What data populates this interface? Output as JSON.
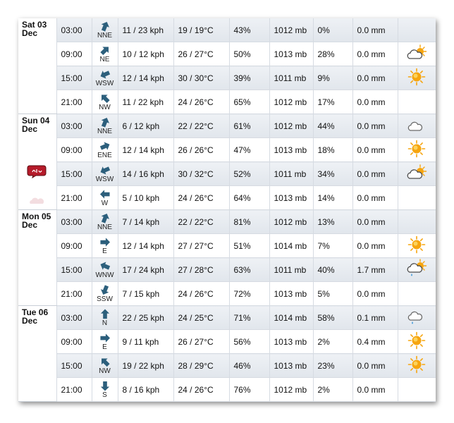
{
  "days": [
    {
      "day_line1": "Sat 03",
      "day_line2": "Dec",
      "rows": [
        {
          "time": "03:00",
          "wind_dir": "NNE",
          "wind_angle": 202,
          "wind_speed": "11 / 23 kph",
          "temp": "19 / 19°C",
          "humidity": "43%",
          "pressure": "1012 mb",
          "rain_chance": "0%",
          "rain_amount": "0.0 mm",
          "icon": "moon-icon"
        },
        {
          "time": "09:00",
          "wind_dir": "NE",
          "wind_angle": 225,
          "wind_speed": "10 / 12 kph",
          "temp": "26 / 27°C",
          "humidity": "50%",
          "pressure": "1013 mb",
          "rain_chance": "28%",
          "rain_amount": "0.0 mm",
          "icon": "sun-cloud-icon"
        },
        {
          "time": "15:00",
          "wind_dir": "WSW",
          "wind_angle": 67,
          "wind_speed": "12 / 14 kph",
          "temp": "30 / 30°C",
          "humidity": "39%",
          "pressure": "1011 mb",
          "rain_chance": "9%",
          "rain_amount": "0.0 mm",
          "icon": "sun-icon"
        },
        {
          "time": "21:00",
          "wind_dir": "NW",
          "wind_angle": 135,
          "wind_speed": "11 / 22 kph",
          "temp": "24 / 26°C",
          "humidity": "65%",
          "pressure": "1012 mb",
          "rain_chance": "17%",
          "rain_amount": "0.0 mm",
          "icon": "moon-icon"
        }
      ]
    },
    {
      "day_line1": "Sun 04",
      "day_line2": "Dec",
      "badge_icon": "speech-bubble-badge-icon",
      "rows": [
        {
          "time": "03:00",
          "wind_dir": "NNE",
          "wind_angle": 202,
          "wind_speed": "6 / 12 kph",
          "temp": "22 / 22°C",
          "humidity": "61%",
          "pressure": "1012 mb",
          "rain_chance": "44%",
          "rain_amount": "0.0 mm",
          "icon": "cloud-moon-icon"
        },
        {
          "time": "09:00",
          "wind_dir": "ENE",
          "wind_angle": 247,
          "wind_speed": "12 / 14 kph",
          "temp": "26 / 26°C",
          "humidity": "47%",
          "pressure": "1013 mb",
          "rain_chance": "18%",
          "rain_amount": "0.0 mm",
          "icon": "sun-icon"
        },
        {
          "time": "15:00",
          "wind_dir": "WSW",
          "wind_angle": 67,
          "wind_speed": "14 / 16 kph",
          "temp": "30 / 32°C",
          "humidity": "52%",
          "pressure": "1011 mb",
          "rain_chance": "34%",
          "rain_amount": "0.0 mm",
          "icon": "sun-cloud-icon"
        },
        {
          "time": "21:00",
          "wind_dir": "W",
          "wind_angle": 90,
          "wind_speed": "5 / 10 kph",
          "temp": "24 / 26°C",
          "humidity": "64%",
          "pressure": "1013 mb",
          "rain_chance": "14%",
          "rain_amount": "0.0 mm",
          "icon": "moon-icon"
        }
      ]
    },
    {
      "day_line1": "Mon 05",
      "day_line2": "Dec",
      "rows": [
        {
          "time": "03:00",
          "wind_dir": "NNE",
          "wind_angle": 202,
          "wind_speed": "7 / 14 kph",
          "temp": "22 / 22°C",
          "humidity": "81%",
          "pressure": "1012 mb",
          "rain_chance": "13%",
          "rain_amount": "0.0 mm",
          "icon": "moon-icon"
        },
        {
          "time": "09:00",
          "wind_dir": "E",
          "wind_angle": 270,
          "wind_speed": "12 / 14 kph",
          "temp": "27 / 27°C",
          "humidity": "51%",
          "pressure": "1014 mb",
          "rain_chance": "7%",
          "rain_amount": "0.0 mm",
          "icon": "sun-icon"
        },
        {
          "time": "15:00",
          "wind_dir": "WNW",
          "wind_angle": 112,
          "wind_speed": "17 / 24 kph",
          "temp": "27 / 28°C",
          "humidity": "63%",
          "pressure": "1011 mb",
          "rain_chance": "40%",
          "rain_amount": "1.7 mm",
          "icon": "sun-cloud-rain-icon"
        },
        {
          "time": "21:00",
          "wind_dir": "SSW",
          "wind_angle": 22,
          "wind_speed": "7 / 15 kph",
          "temp": "24 / 26°C",
          "humidity": "72%",
          "pressure": "1013 mb",
          "rain_chance": "5%",
          "rain_amount": "0.0 mm",
          "icon": "moon-icon"
        }
      ]
    },
    {
      "day_line1": "Tue 06",
      "day_line2": "Dec",
      "rows": [
        {
          "time": "03:00",
          "wind_dir": "N",
          "wind_angle": 180,
          "wind_speed": "22 / 25 kph",
          "temp": "24 / 25°C",
          "humidity": "71%",
          "pressure": "1014 mb",
          "rain_chance": "58%",
          "rain_amount": "0.1 mm",
          "icon": "cloud-moon-rain-icon"
        },
        {
          "time": "09:00",
          "wind_dir": "E",
          "wind_angle": 270,
          "wind_speed": "9 / 11 kph",
          "temp": "26 / 27°C",
          "humidity": "56%",
          "pressure": "1013 mb",
          "rain_chance": "2%",
          "rain_amount": "0.4 mm",
          "icon": "sun-icon"
        },
        {
          "time": "15:00",
          "wind_dir": "NW",
          "wind_angle": 135,
          "wind_speed": "19 / 22 kph",
          "temp": "28 / 29°C",
          "humidity": "46%",
          "pressure": "1013 mb",
          "rain_chance": "23%",
          "rain_amount": "0.0 mm",
          "icon": "sun-icon"
        },
        {
          "time": "21:00",
          "wind_dir": "S",
          "wind_angle": 0,
          "wind_speed": "8 / 16 kph",
          "temp": "24 / 26°C",
          "humidity": "76%",
          "pressure": "1012 mb",
          "rain_chance": "2%",
          "rain_amount": "0.0 mm",
          "icon": "moon-icon"
        }
      ]
    }
  ],
  "colors": {
    "arrow": "#2c5f7c",
    "sun": "#f6a50f",
    "badge": "#b51b2a",
    "cell_border": "#d6dbe2",
    "shade_top": "#eef1f5",
    "shade_bottom": "#e1e6ec"
  }
}
